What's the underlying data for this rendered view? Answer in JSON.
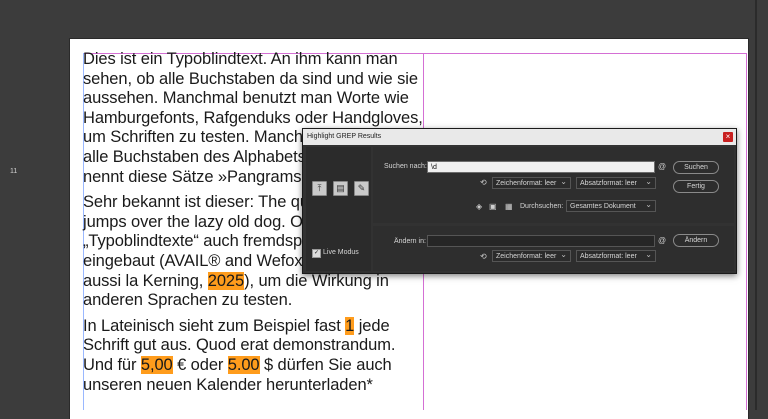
{
  "document": {
    "paragraphs": [
      [
        {
          "text": "Dies ist ein Typoblindtext. An ihm kann man sehen, ob alle Buchstaben da sind und wie sie aussehen. Manchmal benutzt man Worte wie Hamburgefonts, Rafgenduks oder Handgloves, um Schriften zu testen. Manchmal Sätze, die alle Buchstaben des Alphabets enthalten - man nennt diese Sätze »Pangrams«.",
          "hl": false
        }
      ],
      [
        {
          "text": "Sehr bekannt ist dieser: The quick brown fox jumps over the lazy old dog. Oft werden in „Typoblindtexte“ auch fremdsprachige Satzteile eingebaut (AVAIL® and Wefox™ are testing aussi la Kerning, ",
          "hl": false
        },
        {
          "text": "2025",
          "hl": true
        },
        {
          "text": "), um die Wirkung in anderen Sprachen zu testen.",
          "hl": false
        }
      ],
      [
        {
          "text": "In Lateinisch sieht zum Beispiel fast ",
          "hl": false
        },
        {
          "text": "1",
          "hl": true
        },
        {
          "text": " jede Schrift gut aus. Quod erat demonstrandum. Und für ",
          "hl": false
        },
        {
          "text": "5,00",
          "hl": true
        },
        {
          "text": " € oder ",
          "hl": false
        },
        {
          "text": "5.00",
          "hl": true
        },
        {
          "text": " $ dürfen Sie auch unseren neuen Kalender herunterladen*",
          "hl": false
        }
      ]
    ]
  },
  "dialog": {
    "title": "Highlight GREP Results",
    "close_icon": "close-icon",
    "result_count": "11",
    "left_icons": [
      "arrow-up-to-top-icon",
      "clipboard-icon",
      "magic-wand-icon"
    ],
    "live_mode_label": "Live Modus",
    "live_mode_checked": true,
    "search_label": "Suchen nach:",
    "search_value": "\\d",
    "char_format_label": "Zeichenformat: leer",
    "para_format_label": "Absatzformat: leer",
    "search_in_label": "Durchsuchen:",
    "search_in_value": "Gesamtes Dokument",
    "replace_label": "Ändern in:",
    "replace_value": "",
    "replace_char_format": "Zeichenformat: leer",
    "replace_para_format": "Absatzformat: leer",
    "btn_search": "Suchen",
    "btn_done": "Fertig",
    "btn_replace": "Ändern",
    "accent_color": "#ff9c1c"
  }
}
